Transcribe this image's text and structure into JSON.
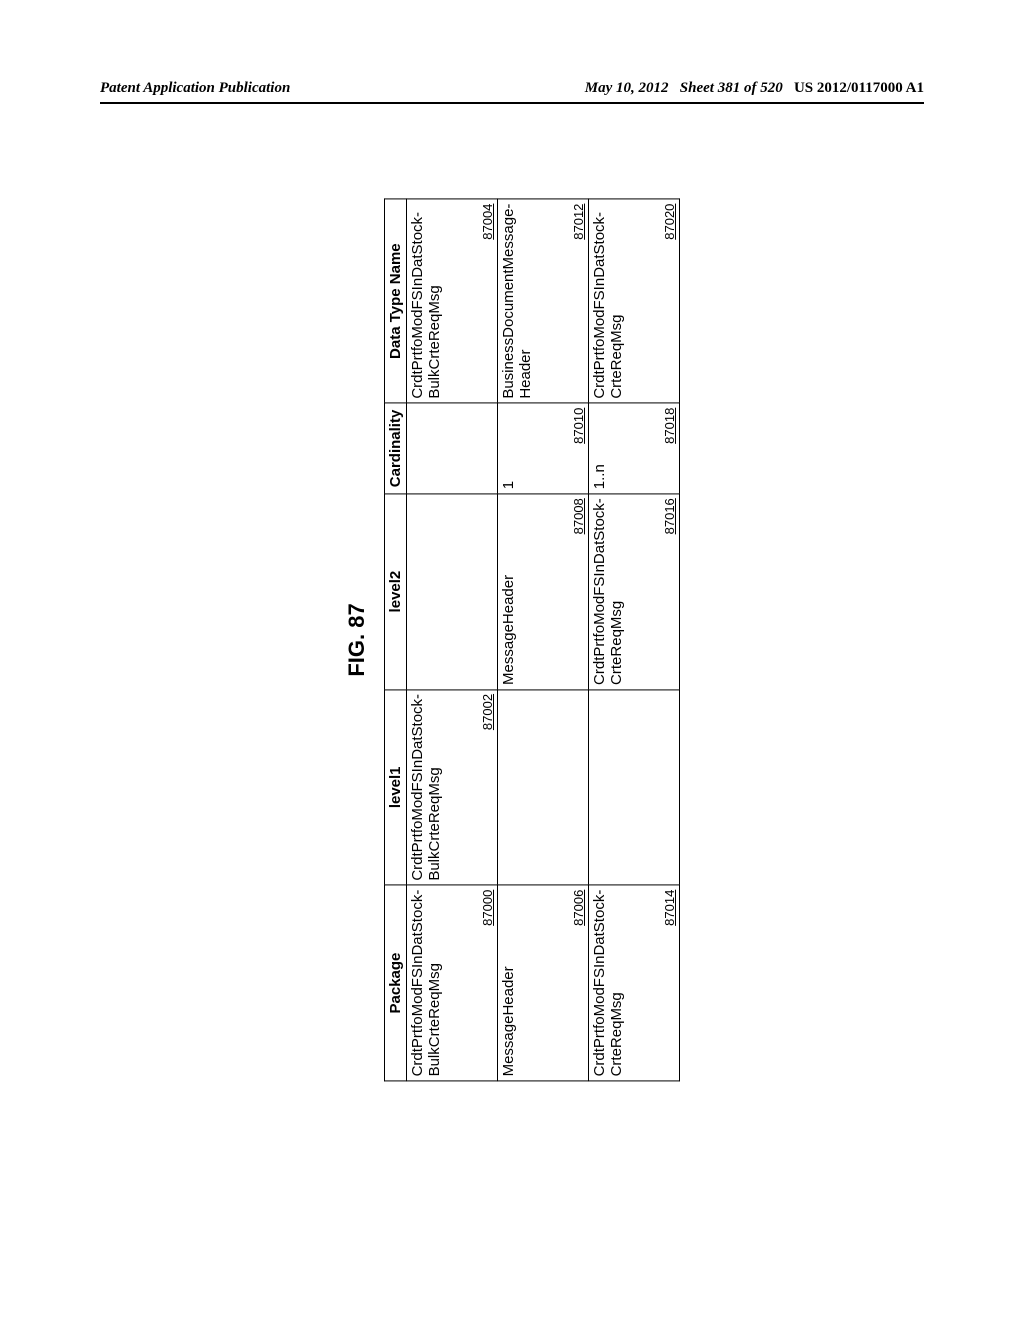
{
  "header": {
    "left": "Patent Application Publication",
    "date": "May 10, 2012",
    "sheet": "Sheet 381 of 520",
    "pubnum": "US 2012/0117000 A1"
  },
  "figure": {
    "title": "FIG. 87",
    "columns": {
      "package": "Package",
      "level1": "level1",
      "level2": "level2",
      "cardinality": "Cardinality",
      "data_type_name": "Data Type Name"
    },
    "rows": [
      {
        "package": "CrdtPrtfoModFSInDatStock-BulkCrteReqMsg",
        "package_ref": "87000",
        "level1": "CrdtPrtfoModFSInDatStock-BulkCrteReqMsg",
        "level1_ref": "87002",
        "level2": "",
        "level2_ref": "",
        "cardinality": "",
        "cardinality_ref": "",
        "data_type_name": "CrdtPrtfoModFSInDatStock-BulkCrteReqMsg",
        "data_type_name_ref": "87004"
      },
      {
        "package": "MessageHeader",
        "package_ref": "87006",
        "level1": "",
        "level1_ref": "",
        "level2": "MessageHeader",
        "level2_ref": "87008",
        "cardinality": "1",
        "cardinality_ref": "87010",
        "data_type_name": "BusinessDocumentMessage-Header",
        "data_type_name_ref": "87012"
      },
      {
        "package": "CrdtPrtfoModFSInDatStock-CrteReqMsg",
        "package_ref": "87014",
        "level1": "",
        "level1_ref": "",
        "level2": "CrdtPrtfoModFSInDatStock-CrteReqMsg",
        "level2_ref": "87016",
        "cardinality": "1..n",
        "cardinality_ref": "87018",
        "data_type_name": "CrdtPrtfoModFSInDatStock-CrteReqMsg",
        "data_type_name_ref": "87020"
      }
    ]
  }
}
